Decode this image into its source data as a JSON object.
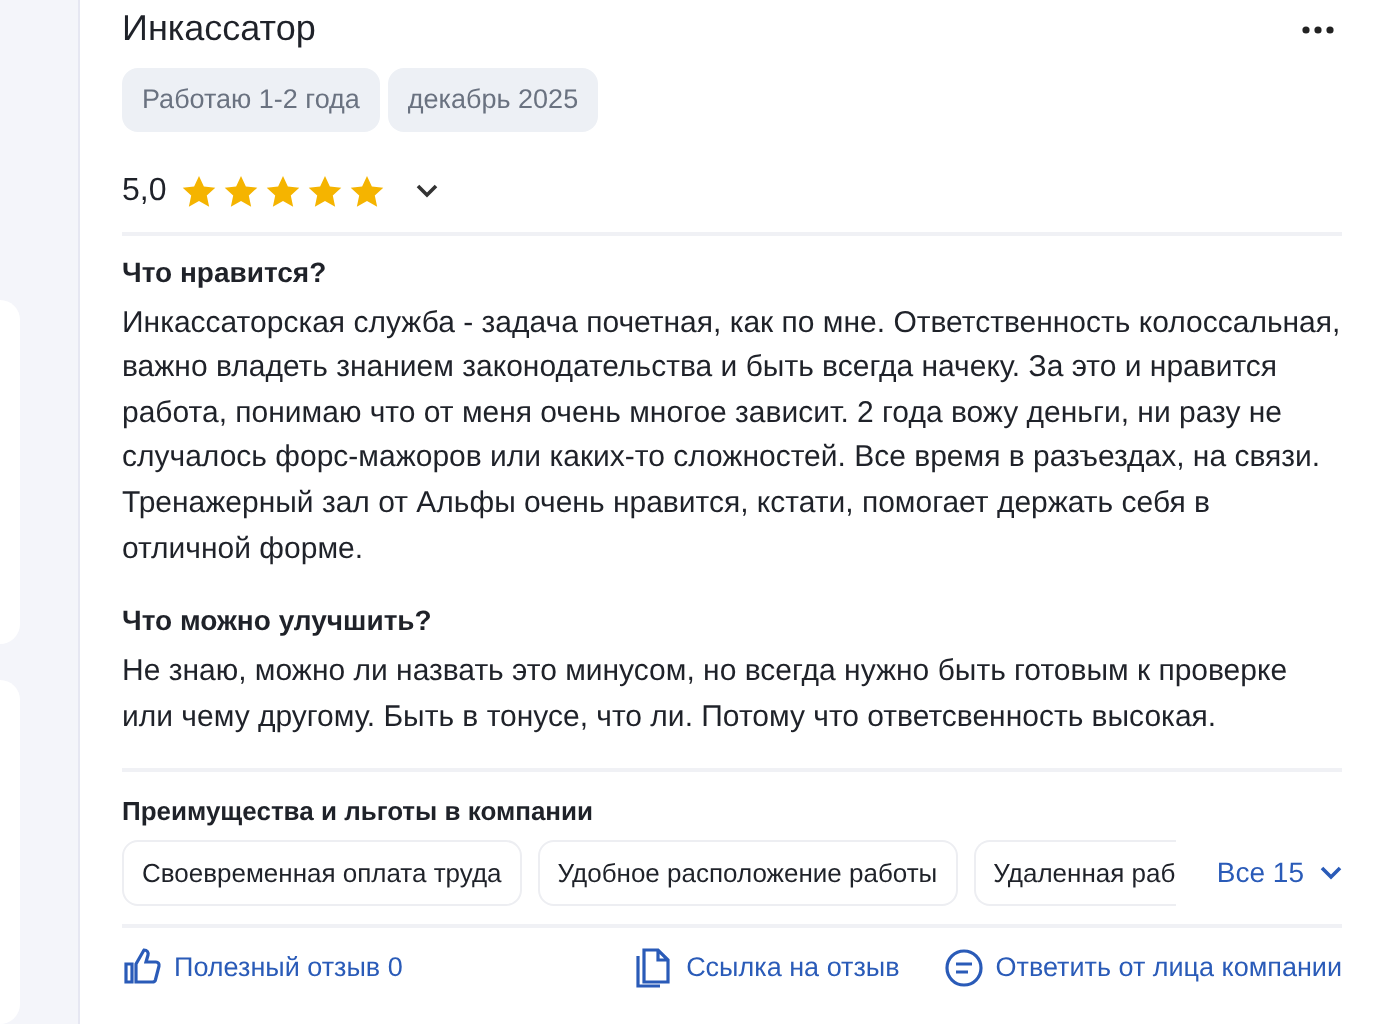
{
  "review": {
    "title": "Инкассатор",
    "tags": [
      "Работаю 1-2 года",
      "декабрь 2025"
    ],
    "rating": {
      "value": "5,0",
      "stars": 5
    },
    "sections": [
      {
        "heading": "Что нравится?",
        "text": "Инкассаторская служба - задача почетная, как по мне. Ответственность колоссальная, важно владеть знанием законодательства и быть всегда начеку. За это и нравится работа, понимаю что от меня очень многое зависит. 2 года вожу деньги, ни разу не случалось форс-мажоров или каких-то сложностей. Все время в разъездах, на связи. Тренажерный зал от Альфы очень нравится, кстати, помогает держать себя в отличной форме."
      },
      {
        "heading": "Что можно улучшить?",
        "text": "Не знаю, можно ли назвать это минусом, но всегда нужно быть готовым к проверке или чему другому. Быть в тонусе, что ли. Потому что ответсвенность высокая."
      }
    ],
    "benefits": {
      "heading": "Преимущества и льготы в компании",
      "items": [
        "Своевременная оплата труда",
        "Удобное расположение работы",
        "Удаленная раб"
      ],
      "more": "Все 15"
    },
    "actions": [
      {
        "kind": "like",
        "label": "Полезный отзыв 0"
      },
      {
        "kind": "link",
        "label": "Ссылка на отзыв"
      },
      {
        "kind": "reply",
        "label": "Ответить от лица компании"
      }
    ]
  }
}
